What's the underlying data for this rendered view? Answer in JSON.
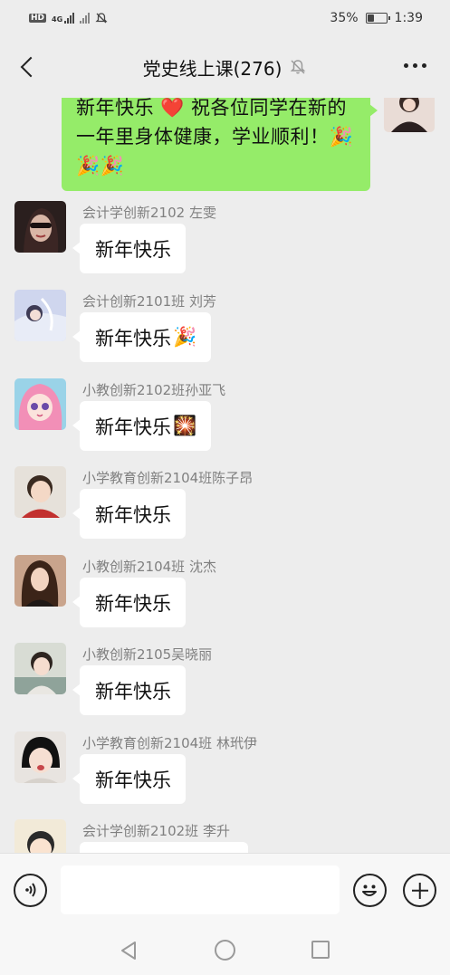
{
  "status_bar": {
    "hd_label": "HD",
    "network_label": "4G",
    "battery_percent": "35%",
    "battery_level": 0.35,
    "time": "1:39",
    "icons": [
      "signal-icon",
      "wifi-off-icon",
      "mute-icon",
      "battery-icon"
    ]
  },
  "header": {
    "title": "党史线上课(276)",
    "back_icon": "back-chevron-icon",
    "mute_icon": "bell-off-icon",
    "more_icon": "more-dots-icon"
  },
  "self_message": {
    "text": "新年快乐 ❤️ 祝各位同学在新的一年里身体健康，学业顺利！🎉🎉🎉"
  },
  "messages": [
    {
      "sender": "会计学创新2102  左雯",
      "text": "新年快乐",
      "emoji": ""
    },
    {
      "sender": "会计创新2101班  刘芳",
      "text": "新年快乐",
      "emoji": "🎉"
    },
    {
      "sender": "小教创新2102班孙亚飞",
      "text": "新年快乐",
      "emoji": "🎇"
    },
    {
      "sender": "小学教育创新2104班陈子昂",
      "text": "新年快乐",
      "emoji": ""
    },
    {
      "sender": "小教创新2104班 沈杰",
      "text": "新年快乐",
      "emoji": ""
    },
    {
      "sender": "小教创新2105吴晓丽",
      "text": "新年快乐",
      "emoji": ""
    },
    {
      "sender": "小学教育创新2104班 林玳伊",
      "text": "新年快乐",
      "emoji": ""
    },
    {
      "sender": "会计学创新2102班 李升",
      "text": "",
      "emoji": ""
    }
  ],
  "input_bar": {
    "value": "",
    "voice_icon": "voice-icon",
    "emoji_icon": "smiley-icon",
    "plus_icon": "plus-icon"
  },
  "nav_bar": {
    "icons": [
      "nav-back-icon",
      "nav-home-icon",
      "nav-recent-icon"
    ]
  },
  "colors": {
    "background": "#ededed",
    "self_bubble": "#95ec69",
    "other_bubble": "#ffffff",
    "sender_text": "#808080"
  }
}
